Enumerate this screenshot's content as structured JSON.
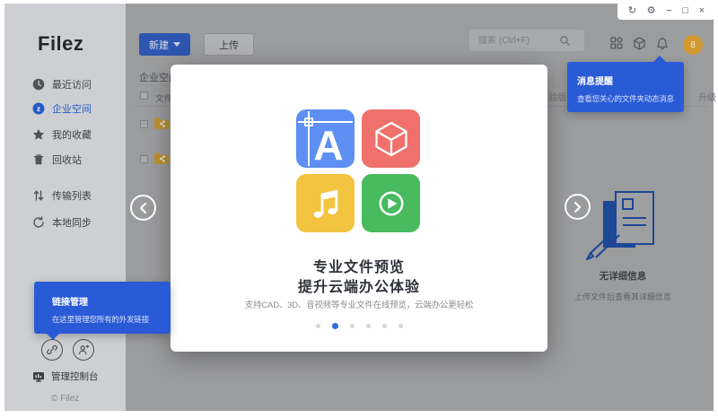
{
  "window_controls": {
    "refresh": "↻",
    "settings": "⚙",
    "minimize": "−",
    "maximize": "□",
    "close": "×"
  },
  "sidebar": {
    "logo": "Filez",
    "nav": [
      {
        "label": "最近访问",
        "icon": "clock-icon",
        "active": false
      },
      {
        "label": "企业空间",
        "icon": "z-badge-icon",
        "active": true
      },
      {
        "label": "我的收藏",
        "icon": "star-icon",
        "active": false
      },
      {
        "label": "回收站",
        "icon": "trash-icon",
        "active": false
      },
      {
        "label": "传输列表",
        "icon": "transfer-icon",
        "active": false
      },
      {
        "label": "本地同步",
        "icon": "sync-icon",
        "active": false
      }
    ],
    "link_tooltip": {
      "title": "链接管理",
      "body": "在这里管理您所有的外发链接"
    },
    "admin_console": "管理控制台",
    "copyright": "© Filez"
  },
  "toolbar": {
    "new_label": "新建",
    "upload_label": "上传",
    "search_placeholder": "搜索 (Ctrl+F)",
    "avatar_text": "8"
  },
  "content": {
    "title": "企业空间",
    "file_column": "文件",
    "banner_trial": "体验版",
    "banner_upgrade": "升级",
    "folder_rows": 2
  },
  "notification_tooltip": {
    "title": "消息提醒",
    "body": "查看您关心的文件夹动态消息"
  },
  "modal": {
    "title_line1": "专业文件预览",
    "title_line2": "提升云端办公体验",
    "subtitle": "支持CAD、3D、音视频等专业文件在线预览，云端办公更轻松",
    "tiles": [
      {
        "name": "cad-preview",
        "color": "#5E8FF2"
      },
      {
        "name": "3d-preview",
        "color": "#F0716B"
      },
      {
        "name": "audio-preview",
        "color": "#F2C440"
      },
      {
        "name": "video-preview",
        "color": "#49BA5E"
      }
    ],
    "dots_total": 6,
    "active_dot_index": 1
  },
  "detail_panel": {
    "title": "无详细信息",
    "subtitle": "上传文件后查看其详细信息"
  },
  "colors": {
    "brand_blue": "#2A5BD7",
    "sidebar_bg": "#CDCFD2",
    "dim_content_bg": "#9B9C9E",
    "avatar_gold": "#D0982F",
    "folder_yellow": "#BE9230"
  }
}
